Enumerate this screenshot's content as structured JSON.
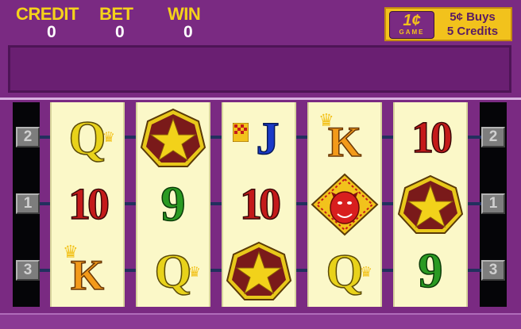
{
  "header": {
    "credit_label": "CREDIT",
    "credit_value": "0",
    "bet_label": "BET",
    "bet_value": "0",
    "win_label": "WIN",
    "win_value": "0"
  },
  "promo": {
    "logo_denomination": "1¢",
    "logo_word": "GAME",
    "line1": "5¢ Buys",
    "line2": "5 Credits"
  },
  "message_bar": "",
  "paylines": {
    "left": [
      "2",
      "1",
      "3"
    ],
    "right": [
      "2",
      "1",
      "3"
    ]
  },
  "reels": [
    [
      {
        "type": "Q",
        "text": "Q"
      },
      {
        "type": "10",
        "text": "10"
      },
      {
        "type": "K",
        "text": "K"
      }
    ],
    [
      {
        "type": "star",
        "text": ""
      },
      {
        "type": "9",
        "text": "9"
      },
      {
        "type": "Q",
        "text": "Q"
      }
    ],
    [
      {
        "type": "J",
        "text": "J"
      },
      {
        "type": "10",
        "text": "10"
      },
      {
        "type": "star",
        "text": ""
      }
    ],
    [
      {
        "type": "K",
        "text": "K"
      },
      {
        "type": "devil",
        "text": ""
      },
      {
        "type": "Q",
        "text": "Q"
      }
    ],
    [
      {
        "type": "10",
        "text": "10"
      },
      {
        "type": "star",
        "text": ""
      },
      {
        "type": "9",
        "text": "9"
      }
    ]
  ],
  "colors": {
    "cabinet": "#7a2a82",
    "reel_face": "#fbf8c8",
    "header_label": "#f5d21a",
    "promo_bg": "#f2c21c"
  }
}
